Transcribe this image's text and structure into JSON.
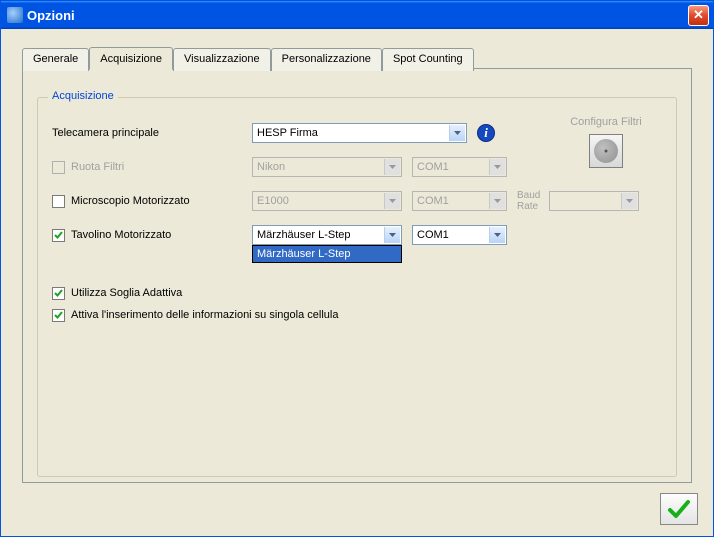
{
  "window": {
    "title": "Opzioni"
  },
  "tabs": {
    "generale": "Generale",
    "acquisizione": "Acquisizione",
    "visualizzazione": "Visualizzazione",
    "personalizzazione": "Personalizzazione",
    "spot_counting": "Spot Counting"
  },
  "group": {
    "title": "Acquisizione"
  },
  "fields": {
    "telecamera_label": "Telecamera principale",
    "telecamera_value": "HESP Firma",
    "ruota_filtri_label": "Ruota Filtri",
    "ruota_filtri_value": "Nikon",
    "ruota_filtri_port": "COM1",
    "microscopio_label": "Microscopio Motorizzato",
    "microscopio_value": "E1000",
    "microscopio_port": "COM1",
    "baud_label": "Baud Rate",
    "baud_value": "",
    "tavolino_label": "Tavolino Motorizzato",
    "tavolino_value": "Märzhäuser L-Step",
    "tavolino_port": "COM1",
    "tavolino_option": "Märzhäuser L-Step",
    "soglia_label": "Utilizza Soglia Adattiva",
    "inserimento_label": "Attiva l'inserimento delle informazioni su singola cellula",
    "configura_filtri": "Configura Filtri"
  },
  "checks": {
    "ruota_filtri": false,
    "microscopio": false,
    "tavolino": true,
    "soglia": true,
    "inserimento": true
  }
}
